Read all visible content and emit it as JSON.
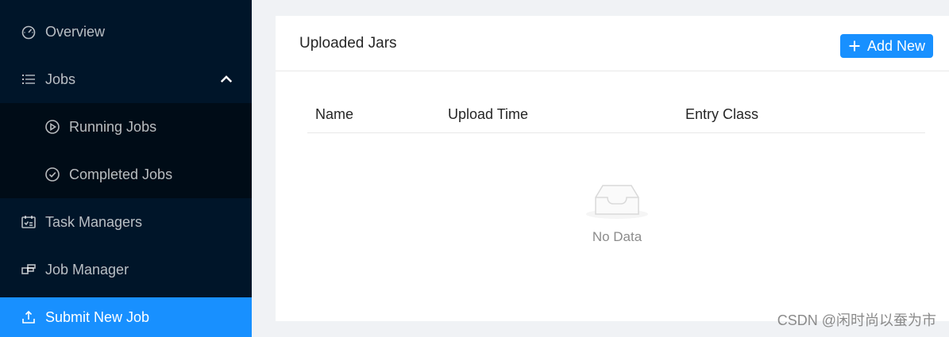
{
  "sidebar": {
    "items": [
      {
        "label": "Overview",
        "icon": "dashboard-icon"
      },
      {
        "label": "Jobs",
        "icon": "list-icon",
        "expanded": true
      },
      {
        "label": "Running Jobs",
        "icon": "play-circle-icon"
      },
      {
        "label": "Completed Jobs",
        "icon": "check-circle-icon"
      },
      {
        "label": "Task Managers",
        "icon": "schedule-icon"
      },
      {
        "label": "Job Manager",
        "icon": "build-icon"
      },
      {
        "label": "Submit New Job",
        "icon": "upload-icon",
        "active": true
      }
    ]
  },
  "main": {
    "title": "Uploaded Jars",
    "add_button_label": "Add New",
    "table": {
      "columns": [
        "Name",
        "Upload Time",
        "Entry Class"
      ],
      "rows": []
    },
    "empty_text": "No Data"
  },
  "watermark": "CSDN @闲时尚以蚕为市",
  "colors": {
    "sidebar_bg": "#001529",
    "submenu_bg": "#000c17",
    "accent": "#1890ff"
  }
}
